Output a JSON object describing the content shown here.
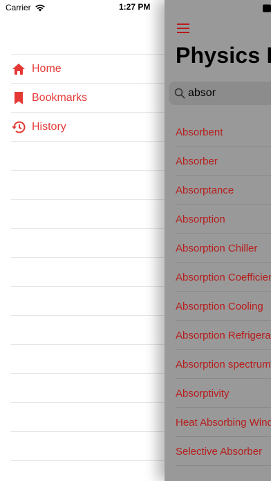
{
  "status_bar": {
    "carrier": "Carrier",
    "time": "1:27 PM"
  },
  "sidebar": {
    "items": [
      {
        "label": "Home",
        "icon": "home-icon"
      },
      {
        "label": "Bookmarks",
        "icon": "bookmark-icon"
      },
      {
        "label": "History",
        "icon": "history-icon"
      }
    ]
  },
  "main": {
    "title": "Physics Dictionary",
    "search": {
      "value": "absor"
    },
    "results": [
      "Absorbent",
      "Absorber",
      "Absorptance",
      "Absorption",
      "Absorption Chiller",
      "Absorption Coefficient",
      "Absorption Cooling",
      "Absorption Refrigeration",
      "Absorption spectrum",
      "Absorptivity",
      "Heat Absorbing Window",
      "Selective Absorber"
    ]
  },
  "colors": {
    "accent": "#e53935",
    "result_text": "#b71c1c",
    "dim_overlay": "#999999"
  }
}
